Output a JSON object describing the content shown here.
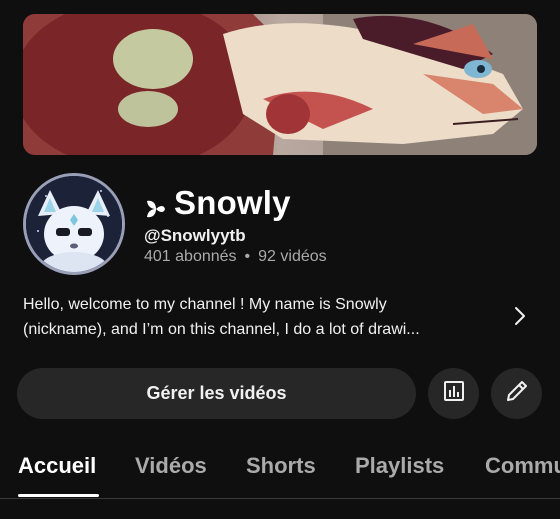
{
  "channel": {
    "name": "Snowly",
    "handle": "@Snowlyytb",
    "subscribers": "401 abonnés",
    "separator": "•",
    "videos": "92 vidéos"
  },
  "description": {
    "line1": "Hello, welcome to my channel ! My name is Snowly",
    "line2": "(nickname), and I’m on this channel, I do a lot of drawi..."
  },
  "actions": {
    "manage_label": "Gérer les vidéos",
    "stats_icon": "analytics-icon",
    "edit_icon": "pencil-icon"
  },
  "tabs": [
    {
      "label": "Accueil",
      "active": true
    },
    {
      "label": "Vidéos",
      "active": false
    },
    {
      "label": "Shorts",
      "active": false
    },
    {
      "label": "Playlists",
      "active": false
    },
    {
      "label": "Commu",
      "active": false
    }
  ],
  "colors": {
    "background": "#0f0f0f",
    "button": "#272727",
    "secondary_text": "#aaaaaa"
  }
}
